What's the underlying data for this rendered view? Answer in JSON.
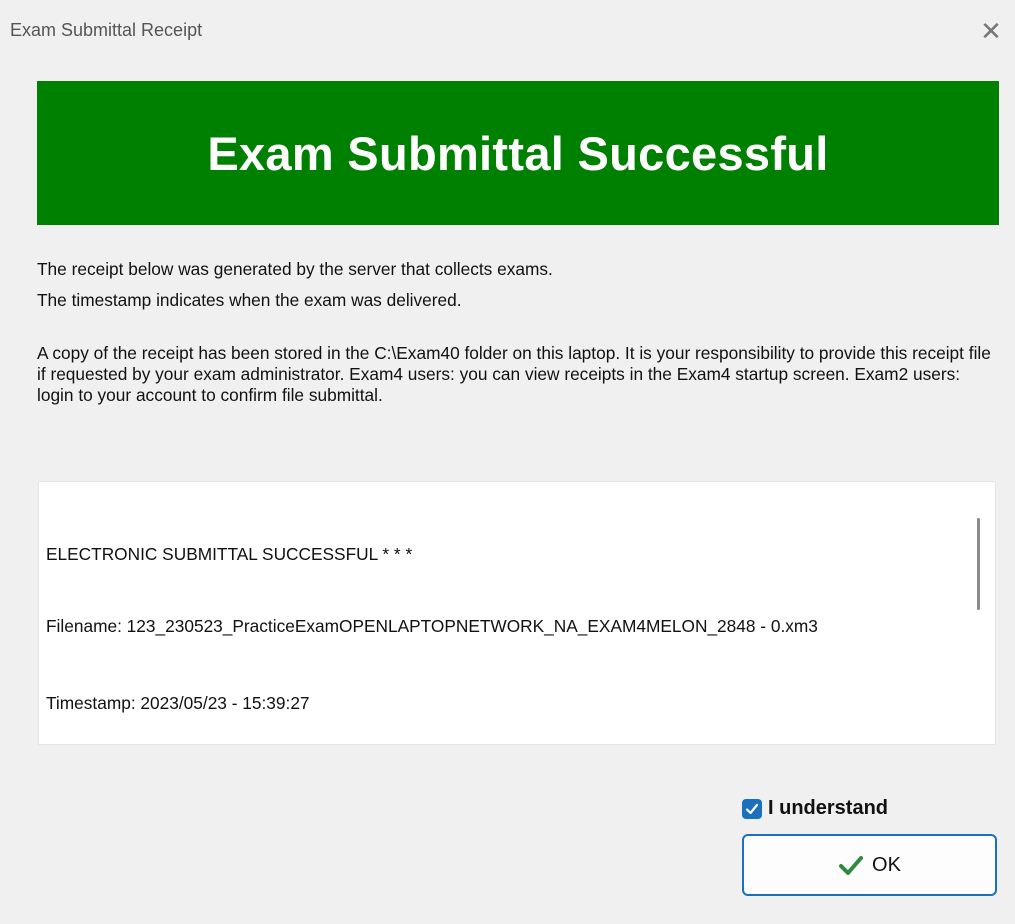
{
  "window": {
    "title": "Exam Submittal Receipt",
    "close_glyph": "✕"
  },
  "banner": {
    "text": "Exam Submittal Successful",
    "color": "#008000"
  },
  "info": {
    "line1": "The receipt below was generated by the server that collects exams.",
    "line2": "The timestamp indicates when the exam was delivered.",
    "line3": "A copy of the receipt has been stored in the C:\\Exam40 folder on this laptop. It is your responsibility to provide this receipt file if requested by your exam administrator. Exam4 users: you can view receipts in the Exam4 startup screen. Exam2 users: login to your account to confirm file submittal."
  },
  "receipt": {
    "status": "ELECTRONIC SUBMITTAL SUCCESSFUL * * *",
    "filename": "Filename: 123_230523_PracticeExamOPENLAPTOPNETWORK_NA_EXAM4MELON_2848 - 0.xm3",
    "timestamp": "Timestamp: 2023/05/23 - 15:39:27"
  },
  "confirm": {
    "checkbox_label": "I understand",
    "checked": true,
    "ok_label": "OK",
    "accent": "#1a6fbf",
    "check_color": "#2e8b3e"
  }
}
